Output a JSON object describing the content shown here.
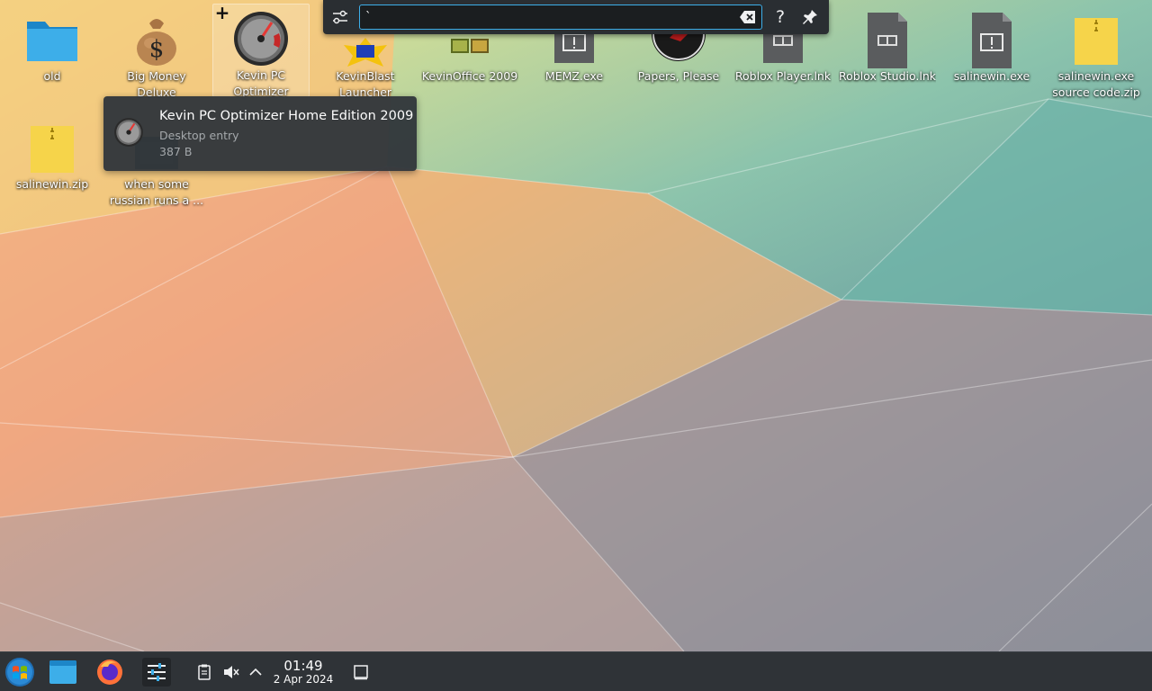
{
  "desktop": {
    "icons": [
      {
        "label": "old",
        "icon": "folder-icon"
      },
      {
        "label": "Big Money Deluxe",
        "icon": "money-bag-icon"
      },
      {
        "label": "Kevin PC Optimizer Hom...",
        "icon": "speedometer-icon"
      },
      {
        "label": "KevinBlast Launcher",
        "icon": "kevinblast-icon"
      },
      {
        "label": "KevinOffice 2009",
        "icon": "kevinoffice-icon"
      },
      {
        "label": "MEMZ.exe",
        "icon": "exe-file-icon"
      },
      {
        "label": "Papers, Please",
        "icon": "papers-please-icon"
      },
      {
        "label": "Roblox Player.lnk",
        "icon": "link-file-icon"
      },
      {
        "label": "Roblox Studio.lnk",
        "icon": "link-file-icon"
      },
      {
        "label": "salinewin.exe",
        "icon": "exe-file-icon"
      },
      {
        "label": "salinewin.exe source code.zip",
        "icon": "zip-file-icon"
      },
      {
        "label": "salinewin.zip",
        "icon": "zip-file-icon"
      },
      {
        "label": "when some russian runs a ...",
        "icon": "video-file-icon"
      }
    ]
  },
  "krunner": {
    "query": "`",
    "help_label": "?"
  },
  "tooltip": {
    "title": "Kevin PC Optimizer Home Edition 2009",
    "type": "Desktop entry",
    "size": "387 B"
  },
  "taskbar": {
    "clock_time": "01:49",
    "clock_date": "2 Apr 2024"
  },
  "colors": {
    "accent": "#3daee9",
    "panel": "#2f3337",
    "krunner_bg": "#2a2e32",
    "folder": "#3daee9",
    "zip": "#f6d44a"
  }
}
